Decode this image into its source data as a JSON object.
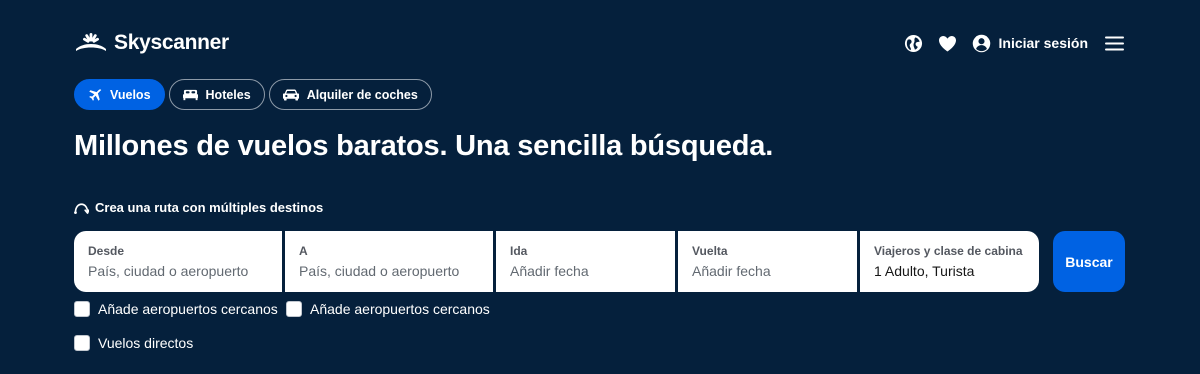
{
  "brand": {
    "name": "Skyscanner"
  },
  "header": {
    "login_label": "Iniciar sesión",
    "icons": [
      "globe-icon",
      "heart-icon",
      "user-icon",
      "menu-icon"
    ]
  },
  "tabs": [
    {
      "label": "Vuelos",
      "icon": "plane-icon",
      "active": true
    },
    {
      "label": "Hoteles",
      "icon": "bed-icon",
      "active": false
    },
    {
      "label": "Alquiler de coches",
      "icon": "car-icon",
      "active": false
    }
  ],
  "headline": "Millones de vuelos baratos. Una sencilla búsqueda.",
  "multi_city_link": "Crea una ruta con múltiples destinos",
  "search": {
    "from": {
      "label": "Desde",
      "placeholder": "País, ciudad o aeropuerto"
    },
    "to": {
      "label": "A",
      "placeholder": "País, ciudad o aeropuerto"
    },
    "depart": {
      "label": "Ida",
      "placeholder": "Añadir fecha"
    },
    "return": {
      "label": "Vuelta",
      "placeholder": "Añadir fecha"
    },
    "travellers": {
      "label": "Viajeros y clase de cabina",
      "value": "1 Adulto, Turista"
    },
    "submit_label": "Buscar"
  },
  "options": {
    "nearby_from": "Añade aeropuertos cercanos",
    "nearby_to": "Añade aeropuertos cercanos",
    "direct": "Vuelos directos"
  },
  "colors": {
    "background": "#05203c",
    "accent": "#0062e3",
    "white": "#ffffff"
  }
}
